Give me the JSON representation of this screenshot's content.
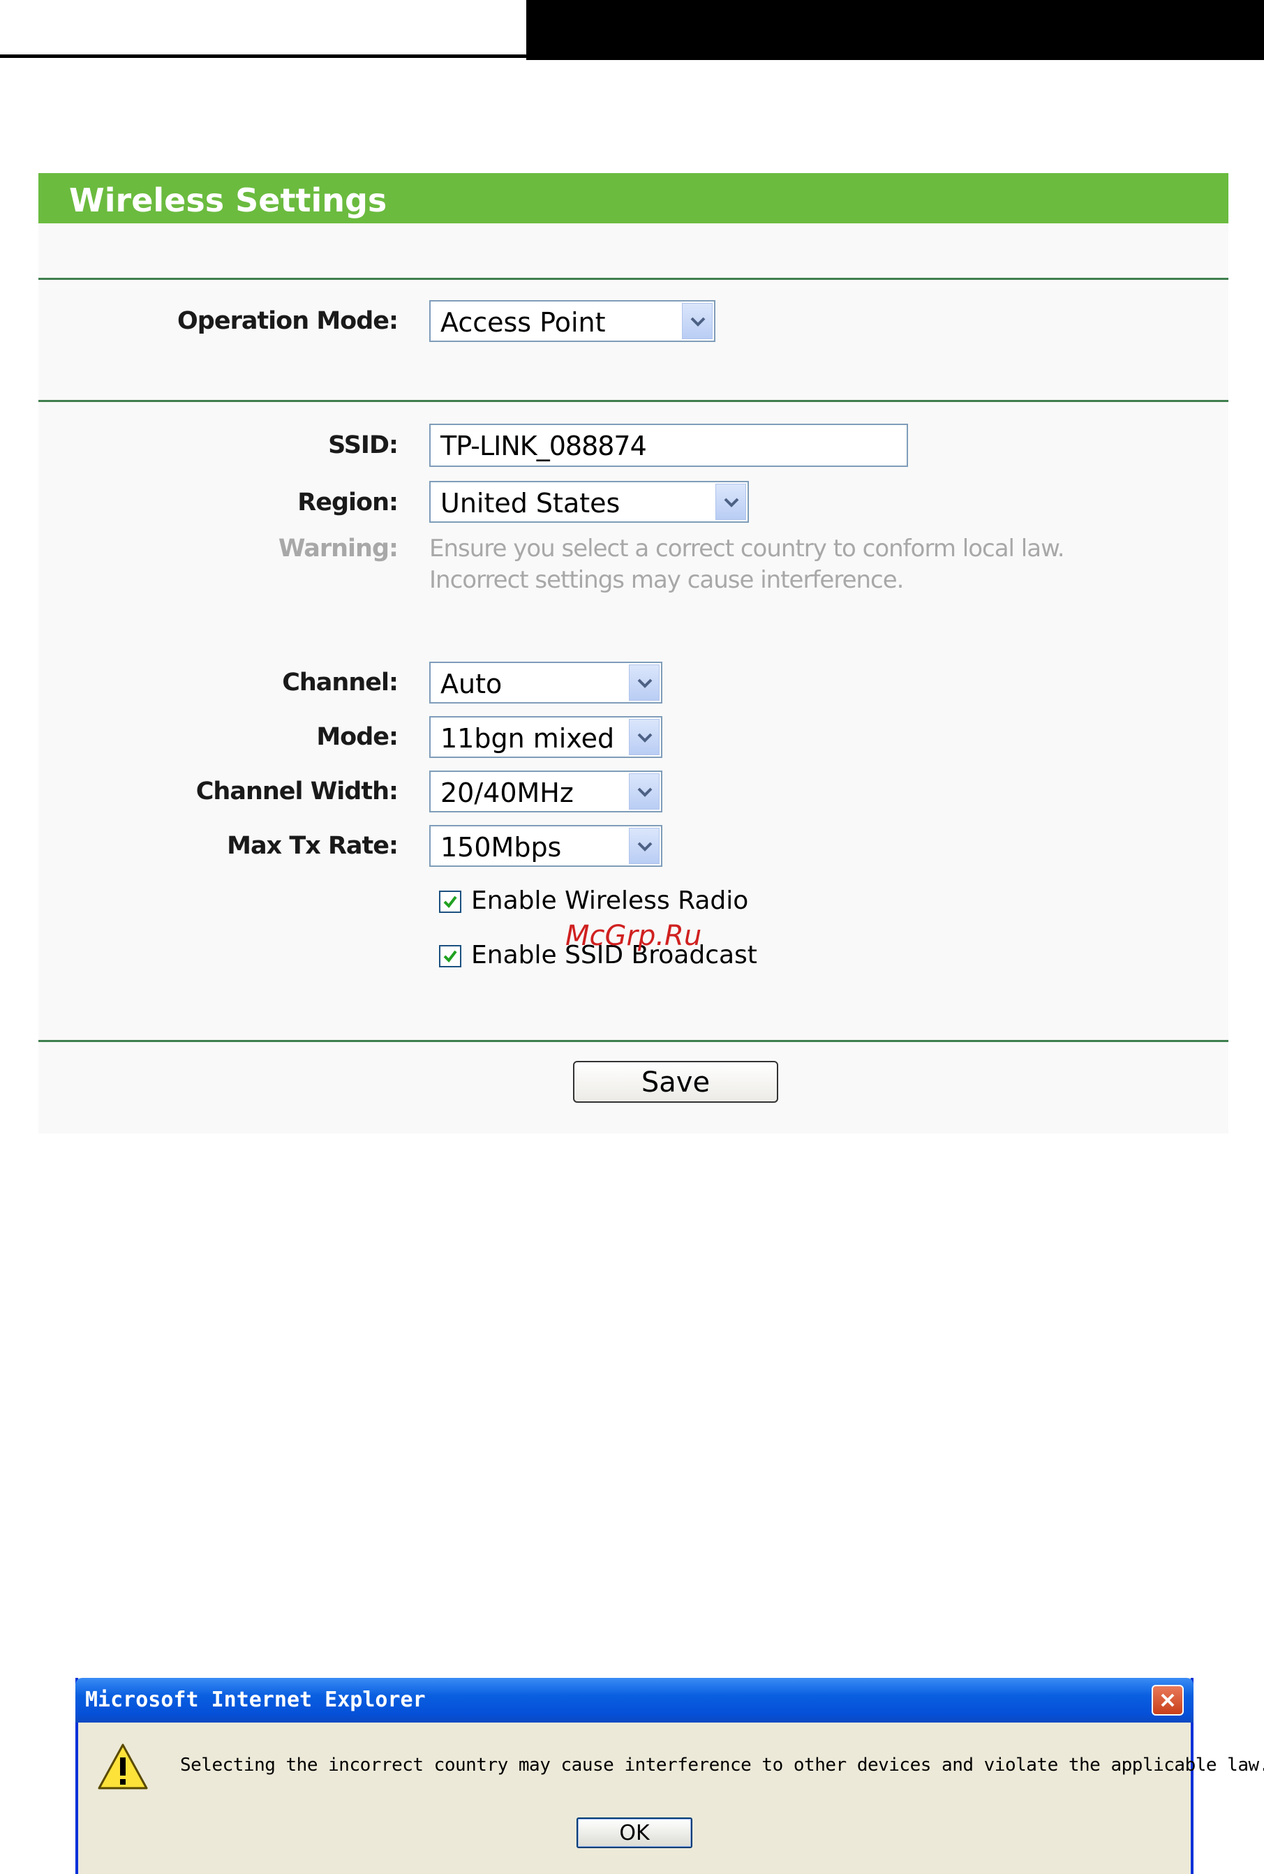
{
  "panel": {
    "title": "Wireless Settings",
    "operation_mode": {
      "label": "Operation Mode:",
      "value": "Access Point"
    },
    "ssid": {
      "label": "SSID:",
      "value": "TP-LINK_088874"
    },
    "region": {
      "label": "Region:",
      "value": "United States"
    },
    "warning": {
      "label": "Warning:",
      "line1": "Ensure you select a correct country to conform local law.",
      "line2": "Incorrect settings may cause interference."
    },
    "channel": {
      "label": "Channel:",
      "value": "Auto"
    },
    "mode": {
      "label": "Mode:",
      "value": "11bgn mixed"
    },
    "channel_width": {
      "label": "Channel Width:",
      "value": "20/40MHz"
    },
    "max_tx_rate": {
      "label": "Max Tx Rate:",
      "value": "150Mbps"
    },
    "enable_wireless_radio": {
      "label": "Enable Wireless Radio",
      "checked": true
    },
    "enable_ssid_broadcast": {
      "label": "Enable SSID Broadcast",
      "checked": true
    },
    "save_label": "Save",
    "watermark": "McGrp.Ru"
  },
  "dialog": {
    "title": "Microsoft Internet Explorer",
    "message": "Selecting the incorrect country may cause interference to other devices and violate the applicable law.",
    "ok_label": "OK"
  },
  "colors": {
    "header_green": "#6bbb3f",
    "divider_green": "#3f7f4f",
    "xp_blue": "#0550d8"
  }
}
